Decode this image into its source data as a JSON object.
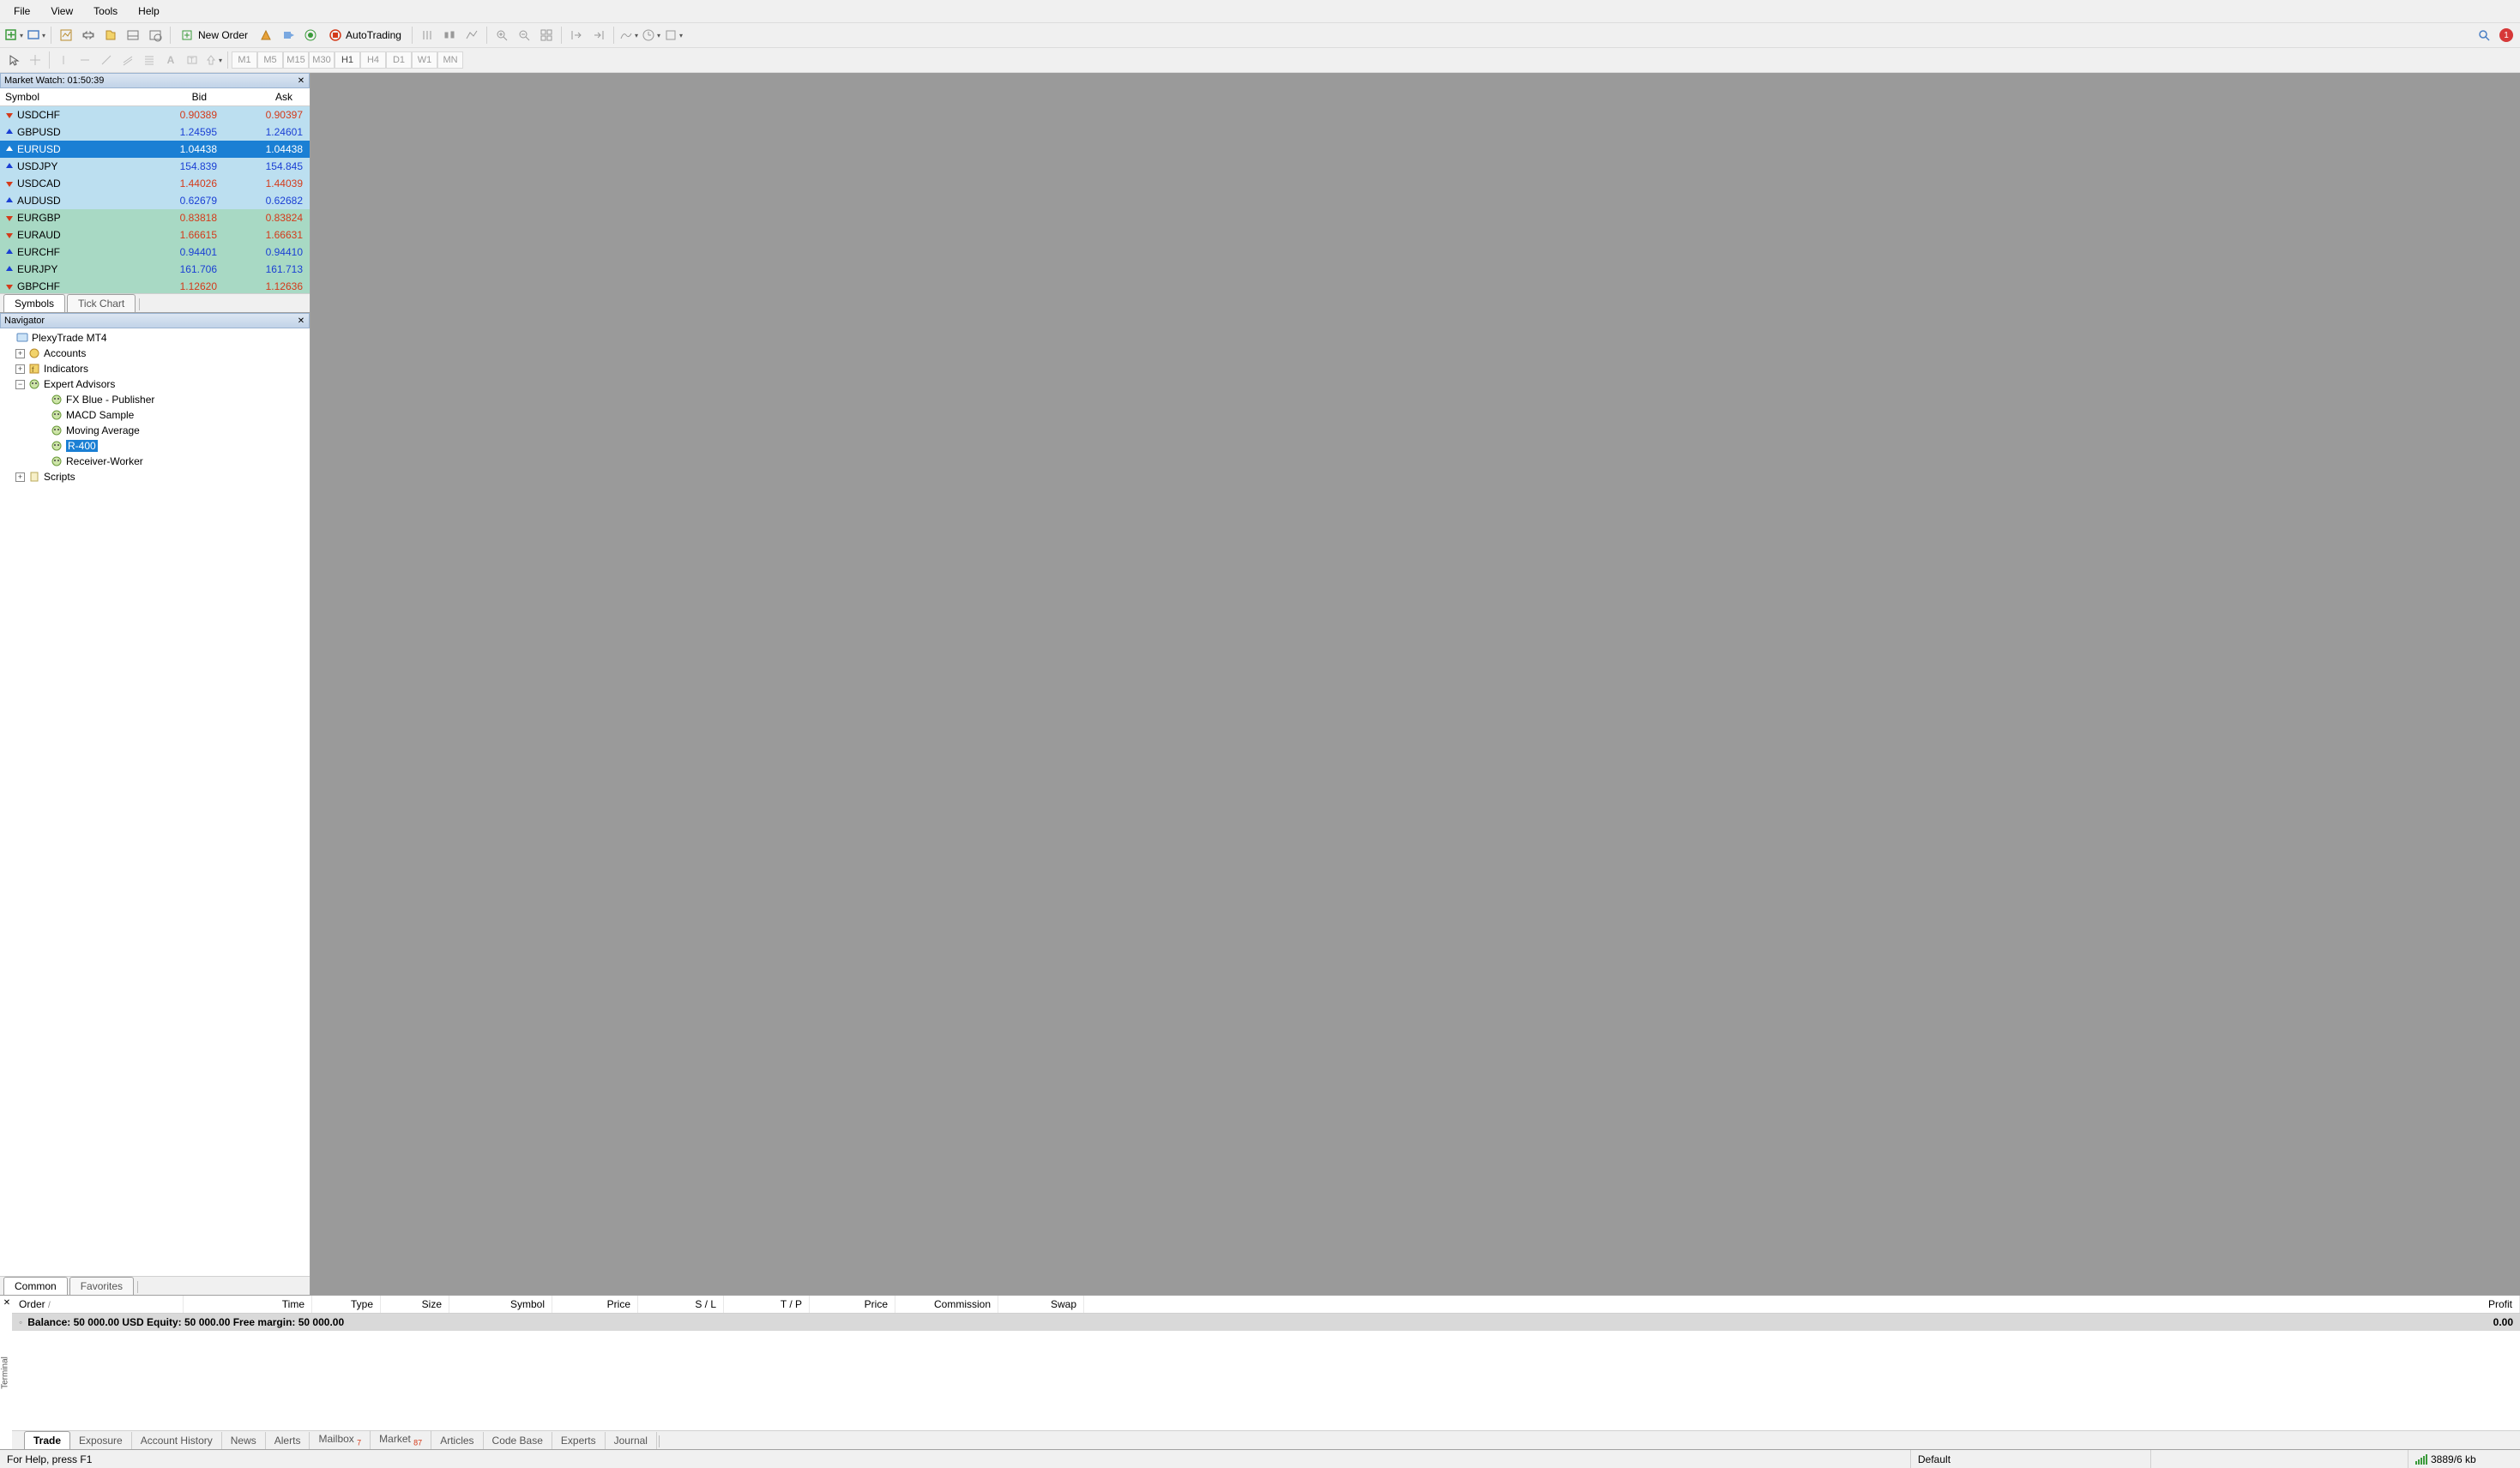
{
  "menubar": [
    "File",
    "View",
    "Tools",
    "Help"
  ],
  "toolbar": {
    "new_order": "New Order",
    "autotrading": "AutoTrading",
    "notification_count": "1"
  },
  "timeframes": [
    "M1",
    "M5",
    "M15",
    "M30",
    "H1",
    "H4",
    "D1",
    "W1",
    "MN"
  ],
  "timeframe_active": "H1",
  "market_watch": {
    "title": "Market Watch: 01:50:39",
    "columns": {
      "symbol": "Symbol",
      "bid": "Bid",
      "ask": "Ask"
    },
    "rows": [
      {
        "symbol": "USDCHF",
        "bid": "0.90389",
        "ask": "0.90397",
        "dir": "down",
        "bg": "blue"
      },
      {
        "symbol": "GBPUSD",
        "bid": "1.24595",
        "ask": "1.24601",
        "dir": "up",
        "bg": "blue"
      },
      {
        "symbol": "EURUSD",
        "bid": "1.04438",
        "ask": "1.04438",
        "dir": "up",
        "bg": "sel"
      },
      {
        "symbol": "USDJPY",
        "bid": "154.839",
        "ask": "154.845",
        "dir": "up",
        "bg": "blue"
      },
      {
        "symbol": "USDCAD",
        "bid": "1.44026",
        "ask": "1.44039",
        "dir": "down",
        "bg": "blue"
      },
      {
        "symbol": "AUDUSD",
        "bid": "0.62679",
        "ask": "0.62682",
        "dir": "up",
        "bg": "blue"
      },
      {
        "symbol": "EURGBP",
        "bid": "0.83818",
        "ask": "0.83824",
        "dir": "down",
        "bg": "green"
      },
      {
        "symbol": "EURAUD",
        "bid": "1.66615",
        "ask": "1.66631",
        "dir": "down",
        "bg": "green"
      },
      {
        "symbol": "EURCHF",
        "bid": "0.94401",
        "ask": "0.94410",
        "dir": "up",
        "bg": "green"
      },
      {
        "symbol": "EURJPY",
        "bid": "161.706",
        "ask": "161.713",
        "dir": "up",
        "bg": "green"
      },
      {
        "symbol": "GBPCHF",
        "bid": "1.12620",
        "ask": "1.12636",
        "dir": "down",
        "bg": "green"
      }
    ],
    "tabs": [
      "Symbols",
      "Tick Chart"
    ],
    "active_tab": "Symbols"
  },
  "navigator": {
    "title": "Navigator",
    "root": "PlexyTrade MT4",
    "accounts": "Accounts",
    "indicators": "Indicators",
    "expert_advisors": "Expert Advisors",
    "ea_children": [
      "FX Blue - Publisher",
      "MACD Sample",
      "Moving Average",
      "R-400",
      "Receiver-Worker"
    ],
    "ea_selected": "R-400",
    "scripts": "Scripts",
    "tabs": [
      "Common",
      "Favorites"
    ],
    "active_tab": "Common"
  },
  "terminal": {
    "label": "Terminal",
    "columns": [
      "Order",
      "Time",
      "Type",
      "Size",
      "Symbol",
      "Price",
      "S / L",
      "T / P",
      "Price",
      "Commission",
      "Swap",
      "Profit"
    ],
    "balance_line": "Balance: 50 000.00 USD  Equity: 50 000.00  Free margin: 50 000.00",
    "profit": "0.00",
    "tabs": [
      {
        "label": "Trade",
        "active": true
      },
      {
        "label": "Exposure"
      },
      {
        "label": "Account History"
      },
      {
        "label": "News"
      },
      {
        "label": "Alerts"
      },
      {
        "label": "Mailbox",
        "badge": "7"
      },
      {
        "label": "Market",
        "badge": "87"
      },
      {
        "label": "Articles"
      },
      {
        "label": "Code Base"
      },
      {
        "label": "Experts"
      },
      {
        "label": "Journal"
      }
    ]
  },
  "statusbar": {
    "help": "For Help, press F1",
    "profile": "Default",
    "connection": "3889/6 kb"
  }
}
